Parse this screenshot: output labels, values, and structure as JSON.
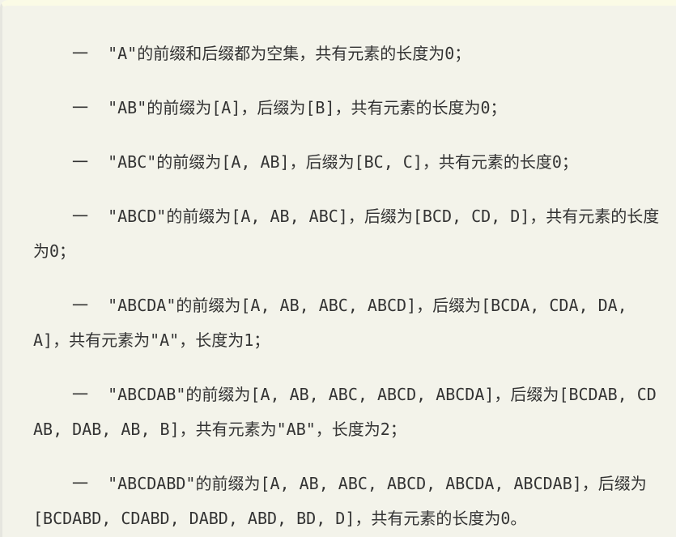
{
  "paragraphs": [
    "一  \"A\"的前缀和后缀都为空集，共有元素的长度为0；",
    "一  \"AB\"的前缀为[A]，后缀为[B]，共有元素的长度为0；",
    "一  \"ABC\"的前缀为[A, AB]，后缀为[BC, C]，共有元素的长度0；",
    "一  \"ABCD\"的前缀为[A, AB, ABC]，后缀为[BCD, CD, D]，共有元素的长度为0；",
    "一  \"ABCDA\"的前缀为[A, AB, ABC, ABCD]，后缀为[BCDA, CDA, DA, A]，共有元素为\"A\"，长度为1；",
    "一  \"ABCDAB\"的前缀为[A, AB, ABC, ABCD, ABCDA]，后缀为[BCDAB, CDAB, DAB, AB, B]，共有元素为\"AB\"，长度为2；",
    "一  \"ABCDABD\"的前缀为[A, AB, ABC, ABCD, ABCDA, ABCDAB]，后缀为[BCDABD, CDABD, DABD, ABD, BD, D]，共有元素的长度为0。"
  ]
}
